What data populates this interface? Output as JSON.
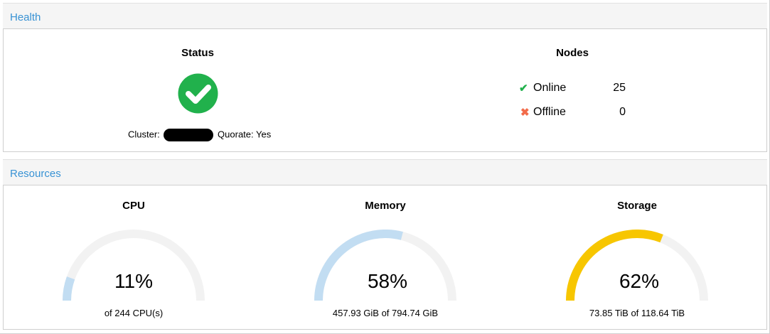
{
  "health": {
    "header": "Health",
    "status_title": "Status",
    "status_icon": "check-circle-icon",
    "status_color": "#21b14c",
    "cluster_label": "Cluster:",
    "quorate_label": "Quorate: Yes",
    "nodes_title": "Nodes",
    "nodes": [
      {
        "label": "Online",
        "count": "25",
        "icon": "check-icon",
        "color": "#21b14c"
      },
      {
        "label": "Offline",
        "count": "0",
        "icon": "cross-icon",
        "color": "#f26b4a"
      }
    ]
  },
  "resources": {
    "header": "Resources",
    "gauges": [
      {
        "title": "CPU",
        "percent": 11,
        "percent_label": "11%",
        "detail": "of 244 CPU(s)",
        "color": "#c2ddf2"
      },
      {
        "title": "Memory",
        "percent": 58,
        "percent_label": "58%",
        "detail": "457.93 GiB of 794.74 GiB",
        "color": "#c2ddf2"
      },
      {
        "title": "Storage",
        "percent": 62,
        "percent_label": "62%",
        "detail": "73.85 TiB of 118.64 TiB",
        "color": "#f7c600"
      }
    ],
    "track_color": "#f2f2f2"
  }
}
